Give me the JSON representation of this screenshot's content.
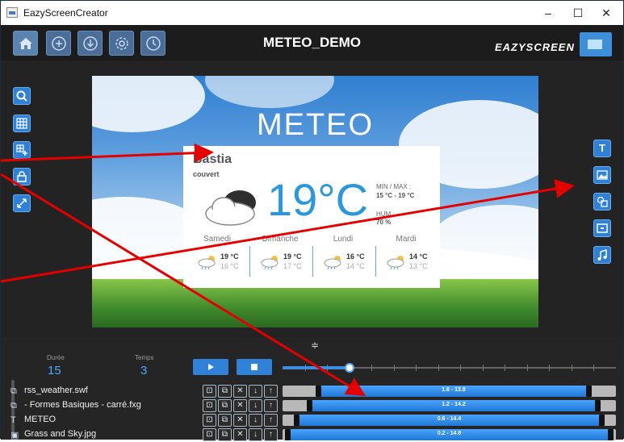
{
  "window": {
    "title": "EazyScreenCreator",
    "controls": {
      "minimize": "–",
      "maximize": "☐",
      "close": "✕"
    }
  },
  "toolbar": {
    "project_title": "METEO_DEMO",
    "logo_text": "EAZYSCREEN",
    "buttons": [
      "home-icon",
      "plus-icon",
      "download-icon",
      "gear-icon",
      "clock-icon"
    ]
  },
  "left_tools": [
    "zoom-icon",
    "grid-icon",
    "grid-add-icon",
    "lock-icon",
    "expand-icon"
  ],
  "right_tools": {
    "text": "T",
    "items": [
      "text-icon",
      "image-icon",
      "shapes-icon",
      "screen-icon",
      "music-icon"
    ]
  },
  "preview": {
    "heading": "METEO",
    "city": "Bastia",
    "condition": "couvert",
    "temperature": "19°C",
    "minmax_label": "MIN / MAX :",
    "minmax_value": "15 °C - 19 °C",
    "hum_label": "HUM :",
    "hum_value": "70 %",
    "forecast": [
      {
        "day": "Samedi",
        "hi": "19 °C",
        "lo": "16 °C"
      },
      {
        "day": "Dimanche",
        "hi": "19 °C",
        "lo": "17 °C"
      },
      {
        "day": "Lundi",
        "hi": "16 °C",
        "lo": "14 °C"
      },
      {
        "day": "Mardi",
        "hi": "14 °C",
        "lo": "13 °C"
      }
    ]
  },
  "timeline": {
    "duree_label": "Durée",
    "duree_value": "15",
    "temps_label": "Temps",
    "temps_value": "3",
    "splitter": "≑",
    "playhead_fraction": 0.2,
    "layers": [
      {
        "icon": "shapes-icon",
        "glyph": "⧉",
        "name": "rss_weather.swf",
        "range": "1.6 - 13.8",
        "start": 1.6,
        "end": 13.8
      },
      {
        "icon": "shapes-icon",
        "glyph": "⧉",
        "name": "- Formes Basiques - carré.fxg",
        "range": "1.2 - 14.2",
        "start": 1.2,
        "end": 14.2
      },
      {
        "icon": "text-icon",
        "glyph": "T",
        "name": "METEO",
        "range": "0.6 - 14.4",
        "start": 0.6,
        "end": 14.4
      },
      {
        "icon": "image-icon",
        "glyph": "▣",
        "name": "Grass and Sky.jpg",
        "range": "0.2 - 14.8",
        "start": 0.2,
        "end": 14.8
      }
    ],
    "layer_controls": [
      "lock-icon",
      "copy-icon",
      "delete-icon",
      "down-icon",
      "up-icon"
    ],
    "layer_control_glyphs": [
      "⊡",
      "⧉",
      "✕",
      "↓",
      "↑"
    ]
  },
  "annotation_color": "#ff0000"
}
